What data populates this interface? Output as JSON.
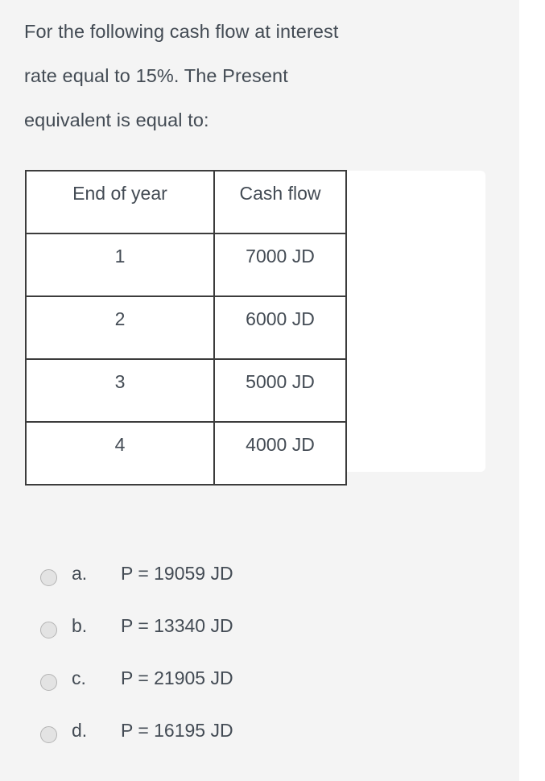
{
  "question": {
    "lines": [
      "For the following cash flow at interest",
      "rate equal to 15%. The Present",
      "equivalent is equal to:"
    ]
  },
  "table": {
    "headers": [
      "End of year",
      "Cash flow"
    ],
    "rows": [
      [
        "1",
        "7000 JD"
      ],
      [
        "2",
        "6000 JD"
      ],
      [
        "3",
        "5000 JD"
      ],
      [
        "4",
        "4000 JD"
      ]
    ]
  },
  "options": [
    {
      "letter": "a.",
      "value": "P = 19059 JD",
      "selected": false
    },
    {
      "letter": "b.",
      "value": "P = 13340 JD",
      "selected": false
    },
    {
      "letter": "c.",
      "value": "P = 21905 JD",
      "selected": false
    },
    {
      "letter": "d.",
      "value": "P = 16195 JD",
      "selected": false
    }
  ],
  "colors": {
    "background": "#f4f4f4",
    "text": "#434b54",
    "table_border": "#3c3c3c",
    "card": "#ffffff",
    "radio_fill": "#e3e3e3",
    "radio_border": "#b4b4b4",
    "gutter_rule": "#d4d4d4"
  }
}
